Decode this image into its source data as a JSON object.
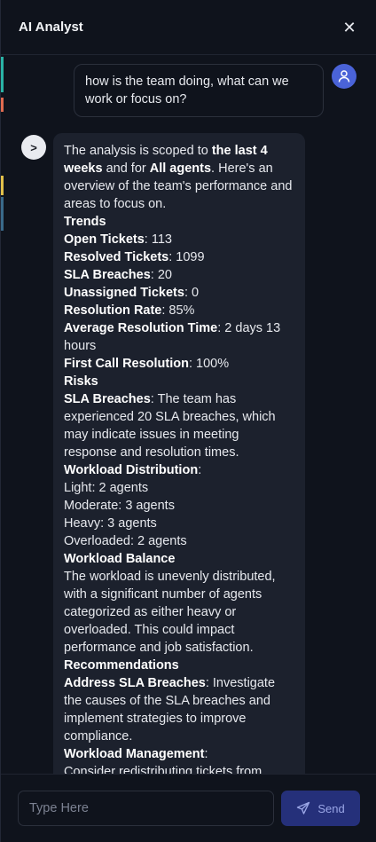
{
  "header": {
    "title": "AI Analyst",
    "close_glyph": "✕"
  },
  "colors": {
    "accent": "#4a63d8",
    "send_bg": "#25307a",
    "bubble_bg": "#1c212d"
  },
  "chat": {
    "user_message": "how is the team doing, what can we work or focus on?",
    "user_avatar_icon": "user-icon",
    "ai_avatar_glyph": ">",
    "ai_intro": {
      "p1": "The analysis is scoped to ",
      "b1": "the last 4 weeks",
      "p2": " and for ",
      "b2": "All agents",
      "p3": ". Here's an overview of the team's performance and areas to focus on."
    },
    "trends_heading": "Trends",
    "metrics": [
      {
        "label": "Open Tickets",
        "value": ": 113"
      },
      {
        "label": "Resolved Tickets",
        "value": ": 1099"
      },
      {
        "label": "SLA Breaches",
        "value": ": 20"
      },
      {
        "label": "Unassigned Tickets",
        "value": ": 0"
      },
      {
        "label": "Resolution Rate",
        "value": ": 85%"
      },
      {
        "label": "Average Resolution Time",
        "value": ": 2 days 13 hours"
      },
      {
        "label": "First Call Resolution",
        "value": ": 100%"
      }
    ],
    "risks_heading": "Risks",
    "risk_sla": {
      "label": "SLA Breaches",
      "text": ": The team has experienced 20 SLA breaches, which may indicate issues in meeting response and resolution times."
    },
    "workload_distribution_label": "Workload Distribution",
    "workload_distribution_colon": ":",
    "workload_items": [
      "Light: 2 agents",
      "Moderate: 3 agents",
      "Heavy: 3 agents",
      "Overloaded: 2 agents"
    ],
    "workload_balance_heading": "Workload Balance",
    "workload_balance_text": "The workload is unevenly distributed, with a significant number of agents categorized as either heavy or overloaded. This could impact performance and job satisfaction.",
    "recommendations_heading": "Recommendations",
    "rec_sla": {
      "label": "Address SLA Breaches",
      "text": ": Investigate the causes of the SLA breaches and implement strategies to improve compliance."
    },
    "rec_workload": {
      "label": "Workload Management",
      "text": ":"
    },
    "rec_workload_cont": "Consider redistributing tickets from"
  },
  "composer": {
    "placeholder": "Type Here",
    "send_label": "Send",
    "send_icon": "paper-plane-icon"
  }
}
